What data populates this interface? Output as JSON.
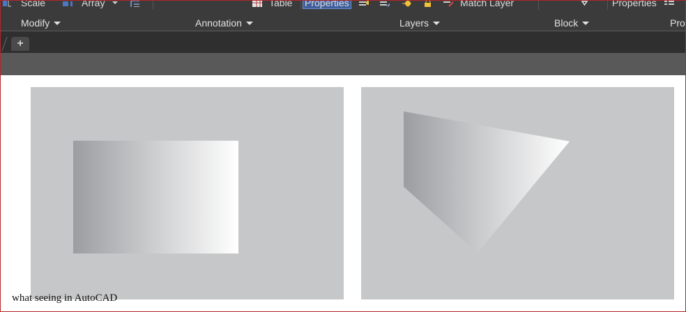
{
  "ribbon": {
    "row1": {
      "scale": "Scale",
      "array": "Array",
      "table": "Table",
      "properties_highlighted": "Properties",
      "match_layer": "Match Layer",
      "properties_right": "Properties"
    },
    "panels": {
      "modify": "Modify",
      "annotation": "Annotation",
      "layers": "Layers",
      "block": "Block",
      "properties_cut": "Pro"
    }
  },
  "tabbar": {
    "add_symbol": "+"
  },
  "caption": "what seeing in AutoCAD",
  "colors": {
    "ribbon_bg": "#3b3b3b",
    "viewport_bg": "#c6c7c9",
    "gradient_dark": "#9c9da0",
    "gradient_light": "#ffffff",
    "frame_border": "#b5262a"
  }
}
